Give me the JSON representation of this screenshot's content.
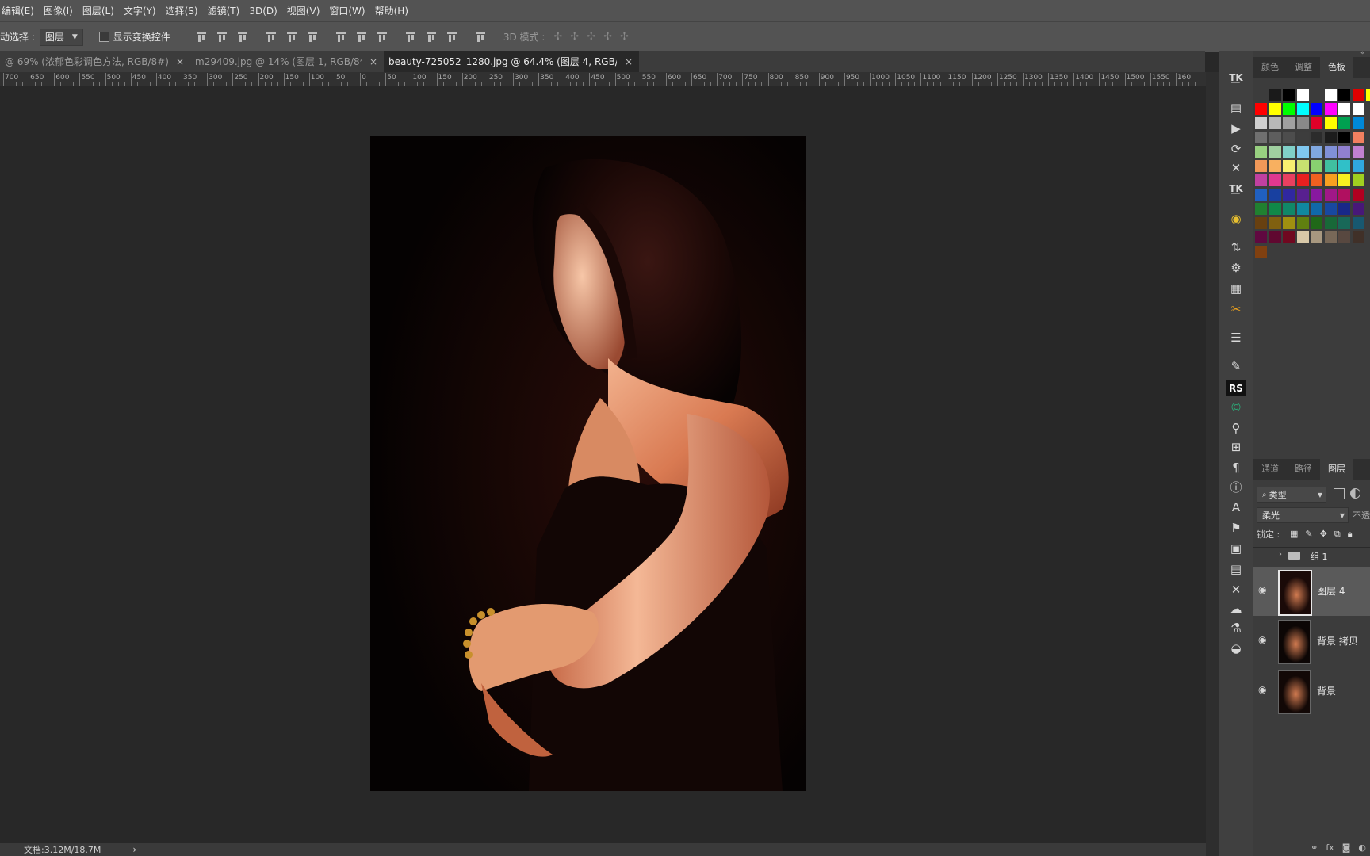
{
  "menu": [
    "编辑(E)",
    "图像(I)",
    "图层(L)",
    "文字(Y)",
    "选择(S)",
    "滤镜(T)",
    "3D(D)",
    "视图(V)",
    "窗口(W)",
    "帮助(H)"
  ],
  "options": {
    "auto_select_label": "动选择 :",
    "auto_select_value": "图层",
    "show_transform_label": "显示变换控件",
    "mode3d_label": "3D 模式 :"
  },
  "tabs": [
    {
      "label": "@ 69% (浓郁色彩调色方法, RGB/8#) *",
      "close": "×",
      "active": false
    },
    {
      "label": "m29409.jpg @ 14% (图层 1, RGB/8*) *",
      "close": "×",
      "active": false
    },
    {
      "label": "beauty-725052_1280.jpg @ 64.4% (图层 4, RGB/8#) *",
      "close": "×",
      "active": true
    }
  ],
  "ruler_labels": [
    "700",
    "650",
    "600",
    "550",
    "500",
    "450",
    "400",
    "350",
    "300",
    "250",
    "200",
    "150",
    "100",
    "50",
    "0",
    "50",
    "100",
    "150",
    "200",
    "250",
    "300",
    "350",
    "400",
    "450",
    "500",
    "550",
    "600",
    "650",
    "700",
    "750",
    "800",
    "850",
    "900",
    "950",
    "1000",
    "1050",
    "1100",
    "1150",
    "1200",
    "1250",
    "1300",
    "1350",
    "1400",
    "1450",
    "1500",
    "1550",
    "160"
  ],
  "status": {
    "doc": "文档:3.12M/18.7M",
    "arrow": "›"
  },
  "color_panel": {
    "tabs": [
      "颜色",
      "调整",
      "色板"
    ],
    "active": 2
  },
  "swatches": [
    [
      "#3c3c3c",
      "#1a1a1a",
      "#000000",
      "#ffffff",
      "#3c3c3c",
      "#ffffff",
      "#000000",
      "#e00000",
      "#ffff00"
    ],
    [
      "#ff0000",
      "#ffff00",
      "#00ff00",
      "#00ffff",
      "#0000ff",
      "#ff00ff",
      "#ffffff",
      "#ffffff",
      "#3c3c3c"
    ],
    [
      "#cfcfcf",
      "#b8b8b8",
      "#a0a0a0",
      "#898989",
      "#e00028",
      "#ffff00",
      "#00a050",
      "#0088d8",
      "#3c3c3c"
    ],
    [
      "#707070",
      "#5e5e5e",
      "#4d4d4d",
      "#3d3d3d",
      "#2c2c2c",
      "#1c1c1c",
      "#000000",
      "#f28060",
      "#3c3c3c"
    ],
    [
      "#98d080",
      "#a0d0a0",
      "#80d0c8",
      "#80c8f0",
      "#80a8e0",
      "#8090d8",
      "#9080d0",
      "#c080d0",
      "#3c3c3c"
    ],
    [
      "#f09858",
      "#f8b060",
      "#f8f070",
      "#c8e070",
      "#88d070",
      "#40c0a0",
      "#30c0c8",
      "#30a8e0",
      "#3c3c3c"
    ],
    [
      "#c040a0",
      "#e03890",
      "#e84060",
      "#e82020",
      "#f06020",
      "#f8a020",
      "#f8f020",
      "#a0d020",
      "#3c3c3c"
    ],
    [
      "#2060c0",
      "#1840a0",
      "#3028a0",
      "#582090",
      "#8818a0",
      "#a01888",
      "#b01060",
      "#b00020",
      "#3c3c3c"
    ],
    [
      "#208030",
      "#108848",
      "#108868",
      "#1088a0",
      "#1068a8",
      "#1848a0",
      "#182888",
      "#481878",
      "#3c3c3c"
    ],
    [
      "#684010",
      "#806010",
      "#a09010",
      "#608010",
      "#206818",
      "#186838",
      "#186858",
      "#185870",
      "#3c3c3c"
    ],
    [
      "#600840",
      "#600830",
      "#700820",
      "#d8c8a8",
      "#a89880",
      "#786858",
      "#584840",
      "#403028",
      "#3c3c3c"
    ],
    [
      "#804010",
      "#3c3c3c",
      "#3c3c3c",
      "#3c3c3c",
      "#3c3c3c",
      "#3c3c3c",
      "#3c3c3c",
      "#3c3c3c",
      "#3c3c3c"
    ]
  ],
  "layers_panel": {
    "tabs": [
      "通道",
      "路径",
      "图层"
    ],
    "active": 2,
    "filter_label": "类型",
    "blend_mode": "柔光",
    "opacity_label": "不透",
    "lock_label": "锁定 :",
    "group_name": "组 1",
    "layers": [
      {
        "name": "图层 4",
        "selected": true
      },
      {
        "name": "背景 拷贝",
        "selected": false
      },
      {
        "name": "背景",
        "selected": false
      }
    ]
  },
  "tools": [
    "TK",
    "clipboard",
    "play",
    "rotate",
    "cross",
    "TK2",
    "color-wheel",
    "adjust",
    "gear",
    "grid",
    "scissors",
    "sliders",
    "brush",
    "RS",
    "C",
    "sprinkle",
    "mesh",
    "¶",
    "ⓘ",
    "A",
    "stamp",
    "layout",
    "doc",
    "x-tool",
    "cloud",
    "flask",
    "palette"
  ]
}
